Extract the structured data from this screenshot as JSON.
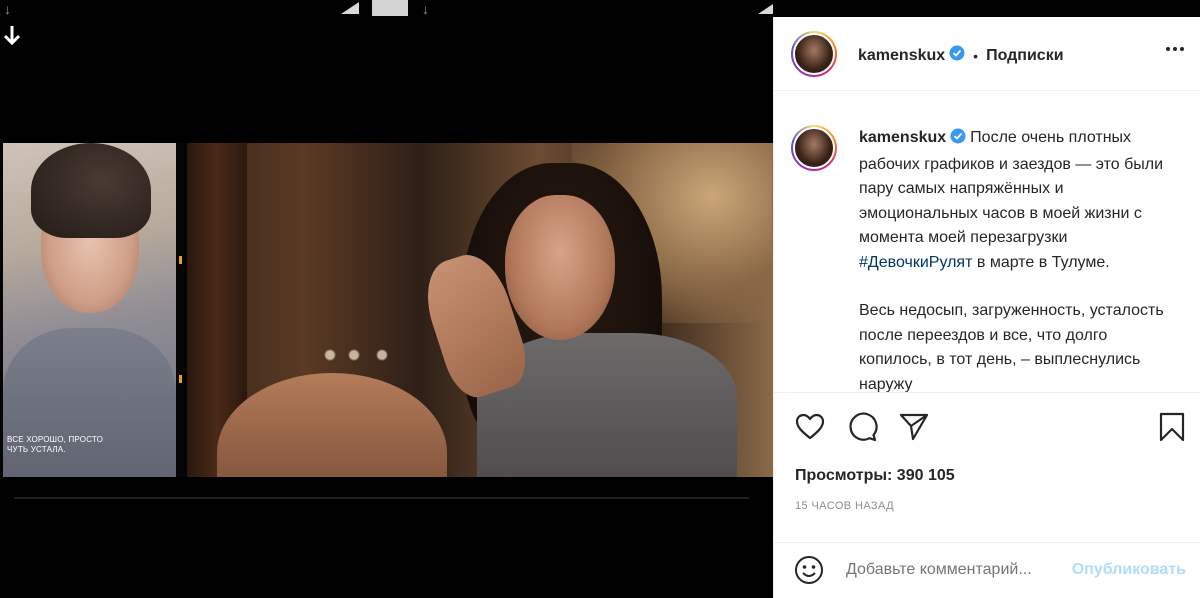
{
  "post": {
    "username": "kamenskux",
    "follow_label": "Подписки",
    "caption_para1": "После очень плотных рабочих графиков и заездов — это были пару самых напряжённых и эмоциональных часов в моей жизни с момента моей перезагрузки",
    "hashtag": "#ДевочкиРулят",
    "caption_para1_tail": " в марте в Тулуме.",
    "caption_para2": "Весь недосып, загруженность, усталость после переездов и все, что долго копилось, в тот день, – выплеснулись наружу",
    "views_label": "Просмотры:",
    "views_value": "390 105",
    "time_ago": "15 ЧАСОВ НАЗАД"
  },
  "video": {
    "subtitle_line1": "ВСЕ ХОРОШО, ПРОСТО",
    "subtitle_line2": "ЧУТЬ УСТАЛА."
  },
  "comment": {
    "placeholder": "Добавьте комментарий...",
    "publish_label": "Опубликовать"
  },
  "colors": {
    "link": "#00376b",
    "publish_disabled": "#b3dbff",
    "verified": "#3897f0"
  },
  "icons": {
    "like": "heart-icon",
    "comment": "speech-bubble-icon",
    "share": "paper-plane-icon",
    "save": "bookmark-icon",
    "emoji": "smiley-icon",
    "more": "ellipsis-icon"
  }
}
